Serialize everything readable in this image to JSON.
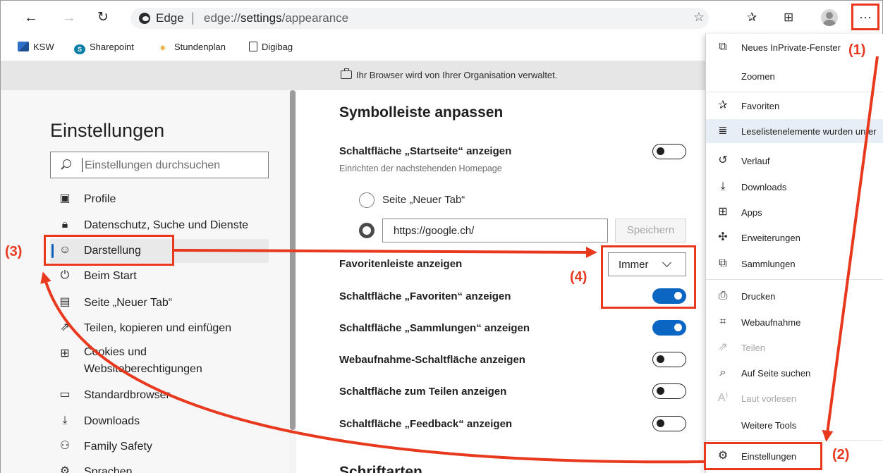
{
  "toolbar": {
    "back_icon": "←",
    "forward_icon": "→",
    "reload_icon": "↻",
    "brand": "Edge",
    "separator": "|",
    "url_prefix": "edge://",
    "url_bold": "settings",
    "url_suffix": "/appearance",
    "star_icon": "☆",
    "favorites_icon": "✰",
    "collections_icon": "⊞",
    "more_icon": "···"
  },
  "favorites_bar": {
    "items": [
      {
        "label": "KSW"
      },
      {
        "label": "Sharepoint",
        "badge": "S"
      },
      {
        "label": "Stundenplan",
        "glyph": "✶"
      },
      {
        "label": "Digibag"
      }
    ]
  },
  "banner": {
    "text": "Ihr Browser wird von Ihrer Organisation verwaltet."
  },
  "sidebar": {
    "title": "Einstellungen",
    "search_placeholder": "Einstellungen durchsuchen",
    "items": [
      {
        "label": "Profile",
        "icon": "▣"
      },
      {
        "label": "Datenschutz, Suche und Dienste",
        "icon": "🔒︎"
      },
      {
        "label": "Darstellung",
        "icon": "☺︎"
      },
      {
        "label": "Beim Start",
        "icon": "⏻"
      },
      {
        "label": "Seite „Neuer Tab“",
        "icon": "▤"
      },
      {
        "label": "Teilen, kopieren und einfügen",
        "icon": "⇗"
      },
      {
        "label_line1": "Cookies und",
        "label_line2": "Websiteberechtigungen",
        "icon": "⊞"
      },
      {
        "label": "Standardbrowser",
        "icon": "▭"
      },
      {
        "label": "Downloads",
        "icon": "⤓"
      },
      {
        "label": "Family Safety",
        "icon": "⚇"
      },
      {
        "label": "Sprachen",
        "icon": "⚙︎"
      }
    ]
  },
  "main": {
    "heading": "Symbolleiste anpassen",
    "home_button": {
      "label": "Schaltfläche „Startseite“ anzeigen",
      "sub": "Einrichten der nachstehenden Homepage"
    },
    "radio_newtab": "Seite „Neuer Tab“",
    "url_value": "https://google.ch/",
    "save_label": "Speichern",
    "favbar_label": "Favoritenleiste anzeigen",
    "favbar_value": "Immer",
    "toggles": [
      {
        "label": "Schaltfläche „Favoriten“ anzeigen",
        "on": true
      },
      {
        "label": "Schaltfläche „Sammlungen“ anzeigen",
        "on": true
      },
      {
        "label": "Webaufnahme-Schaltfläche anzeigen",
        "on": false
      },
      {
        "label": "Schaltfläche zum Teilen anzeigen",
        "on": false
      },
      {
        "label": "Schaltfläche „Feedback“ anzeigen",
        "on": false
      }
    ],
    "next_heading": "Schriftarten"
  },
  "menu": {
    "items": [
      {
        "label": "Neues InPrivate-Fenster",
        "icon": "⧉"
      },
      {
        "label": "Zoomen",
        "icon": ""
      },
      {
        "label": "Favoriten",
        "icon": "✰"
      },
      {
        "label": "Leselistenelemente wurden unter",
        "icon": "≣"
      },
      {
        "label": "Verlauf",
        "icon": "↺"
      },
      {
        "label": "Downloads",
        "icon": "⤓"
      },
      {
        "label": "Apps",
        "icon": "⊞"
      },
      {
        "label": "Erweiterungen",
        "icon": "✣"
      },
      {
        "label": "Sammlungen",
        "icon": "⧉"
      },
      {
        "label": "Drucken",
        "icon": "⎙"
      },
      {
        "label": "Webaufnahme",
        "icon": "⌗"
      },
      {
        "label": "Teilen",
        "icon": "⇗"
      },
      {
        "label": "Auf Seite suchen",
        "icon": "⌕"
      },
      {
        "label": "Laut vorlesen",
        "icon": "A⁾"
      },
      {
        "label": "Weitere Tools",
        "icon": ""
      },
      {
        "label": "Einstellungen",
        "icon": "⚙︎"
      }
    ]
  },
  "annotations": {
    "a1": "(1)",
    "a2": "(2)",
    "a3": "(3)",
    "a4": "(4)"
  },
  "colors": {
    "annotation": "#e8391f",
    "toggle_on": "#0a66c2",
    "active_accent": "#0a5fbf"
  }
}
